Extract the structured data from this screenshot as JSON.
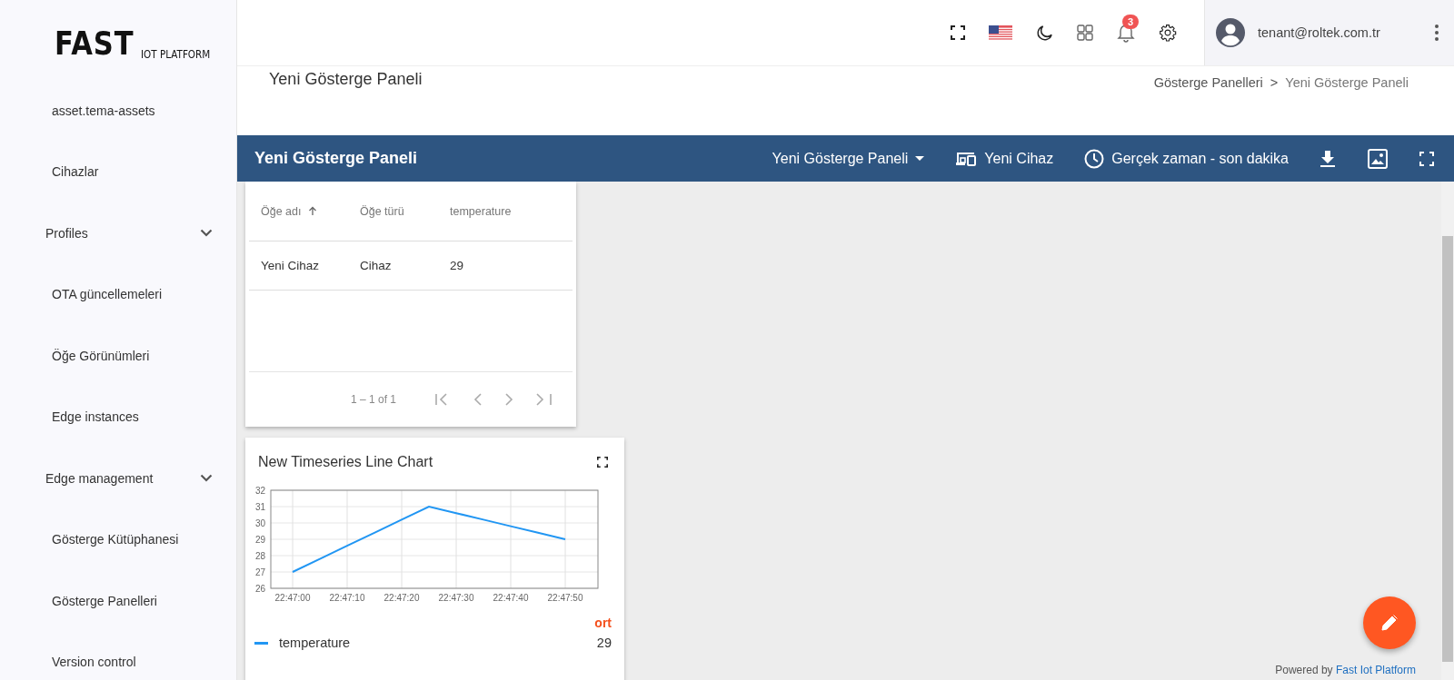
{
  "logo": {
    "main": "FAST",
    "sub": "IOT PLATFORM"
  },
  "sidebar": {
    "items": [
      {
        "label": "asset.tema-assets",
        "kind": "link"
      },
      {
        "label": "Cihazlar",
        "kind": "link"
      },
      {
        "label": "Profiles",
        "kind": "group"
      },
      {
        "label": "OTA güncellemeleri",
        "kind": "link"
      },
      {
        "label": "Öğe Görünümleri",
        "kind": "link"
      },
      {
        "label": "Edge instances",
        "kind": "link"
      },
      {
        "label": "Edge management",
        "kind": "group"
      },
      {
        "label": "Gösterge Kütüphanesi",
        "kind": "link"
      },
      {
        "label": "Gösterge Panelleri",
        "kind": "link"
      },
      {
        "label": "Version control",
        "kind": "link"
      }
    ]
  },
  "topbar": {
    "notification_count": "3",
    "user": "tenant@roltek.com.tr"
  },
  "page": {
    "title": "Yeni Gösterge Paneli",
    "breadcrumb": [
      "Gösterge Panelleri",
      ">",
      "Yeni Gösterge Paneli"
    ]
  },
  "toolbar": {
    "title": "Yeni Gösterge Paneli",
    "dashboard_state": "Yeni Gösterge Paneli",
    "entity": "Yeni Cihaz",
    "timewindow": "Gerçek zaman - son dakika"
  },
  "table_widget": {
    "columns": [
      {
        "label": "Öğe adı",
        "sorted": true
      },
      {
        "label": "Öğe türü",
        "sorted": false
      },
      {
        "label": "temperature",
        "sorted": false
      }
    ],
    "rows": [
      [
        "Yeni Cihaz",
        "Cihaz",
        "29"
      ]
    ],
    "range": "1 – 1 of 1"
  },
  "chart_widget": {
    "title": "New Timeseries Line Chart",
    "chart_data": {
      "type": "line",
      "grid": true,
      "categories": [
        "22:47:00",
        null,
        "22:47:10",
        null,
        "22:47:20",
        null,
        "22:47:30",
        null,
        "22:47:40",
        null,
        "22:47:50",
        null
      ],
      "series": [
        {
          "name": "temperature",
          "color": "#2196f3",
          "values": [
            27,
            27.8,
            28.6,
            29.4,
            30.2,
            31,
            30.6,
            30.2,
            29.8,
            29.4,
            29,
            null
          ]
        }
      ],
      "ylim": [
        26,
        32
      ],
      "yticks": [
        26,
        27,
        28,
        29,
        30,
        31,
        32
      ]
    },
    "legend_header": "ort",
    "legend": [
      {
        "value": "29"
      }
    ]
  },
  "footer": {
    "prefix": "Powered by",
    "link": "Fast Iot Platform"
  }
}
